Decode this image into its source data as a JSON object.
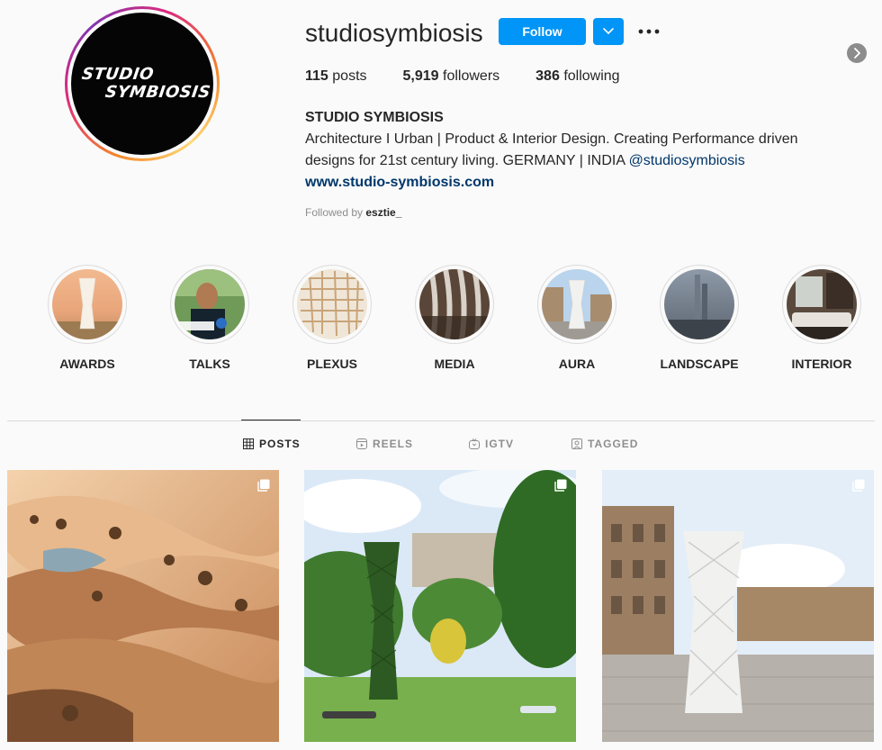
{
  "profile": {
    "username": "studiosymbiosis",
    "avatar_text_line1": "STUDIO",
    "avatar_text_line2": "SYMBIOSIS",
    "follow_label": "Follow",
    "dropdown_icon": "chevron-down-icon",
    "more_icon": "more-options-icon",
    "accent_color": "#0095f6"
  },
  "stats": {
    "posts_count": "115",
    "posts_label": "posts",
    "followers_count": "5,919",
    "followers_label": "followers",
    "following_count": "386",
    "following_label": "following"
  },
  "bio": {
    "name": "STUDIO SYMBIOSIS",
    "text": "Architecture I Urban | Product & Interior Design. Creating Performance driven designs for 21st century living. GERMANY | INDIA ",
    "mention": "@studiosymbiosis",
    "link": "www.studio-symbiosis.com",
    "followed_by_prefix": "Followed by",
    "followed_by_user": "esztie_"
  },
  "highlights": [
    {
      "label": "AWARDS"
    },
    {
      "label": "TALKS"
    },
    {
      "label": "PLEXUS"
    },
    {
      "label": "MEDIA"
    },
    {
      "label": "AURA"
    },
    {
      "label": "LANDSCAPE"
    },
    {
      "label": "INTERIOR"
    }
  ],
  "tabs": [
    {
      "label": "POSTS",
      "icon": "grid-icon",
      "active": true
    },
    {
      "label": "REELS",
      "icon": "reels-icon",
      "active": false
    },
    {
      "label": "IGTV",
      "icon": "igtv-icon",
      "active": false
    },
    {
      "label": "TAGGED",
      "icon": "tagged-icon",
      "active": false
    }
  ],
  "posts": [
    {
      "icon": "multiple-posts-icon"
    },
    {
      "icon": "multiple-posts-icon"
    },
    {
      "icon": "multiple-posts-icon"
    }
  ]
}
